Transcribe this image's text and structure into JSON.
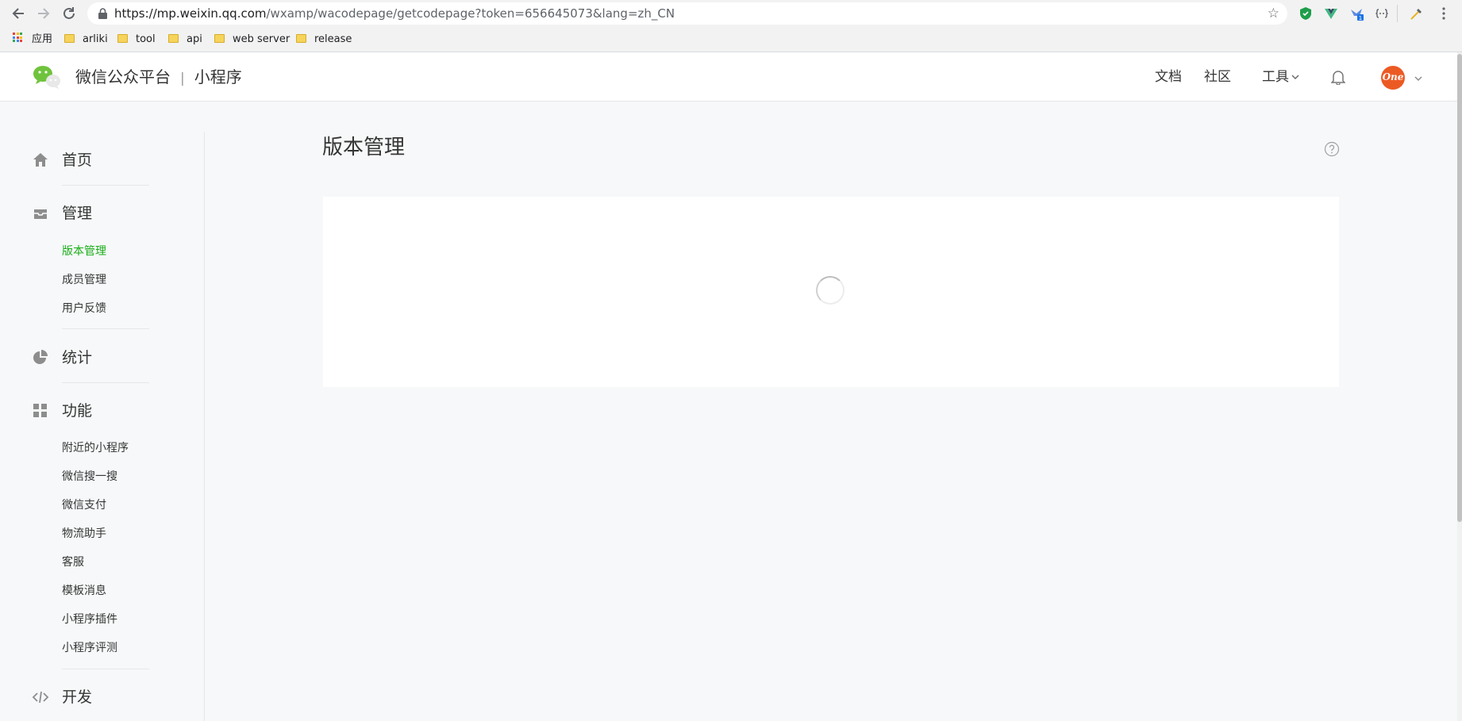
{
  "browser": {
    "url_host": "https://mp.weixin.qq.com",
    "url_path": "/wxamp/wacodepage/getcodepage?token=656645073&lang=zh_CN",
    "bookmarks": [
      {
        "label": "应用",
        "type": "apps"
      },
      {
        "label": "arliki",
        "type": "folder"
      },
      {
        "label": "tool",
        "type": "folder"
      },
      {
        "label": "api",
        "type": "folder"
      },
      {
        "label": "web server",
        "type": "folder"
      },
      {
        "label": "release",
        "type": "folder"
      }
    ],
    "extension_badge": "1"
  },
  "header": {
    "brand": "微信公众平台",
    "separator": "|",
    "product": "小程序",
    "nav": {
      "docs": "文档",
      "community": "社区",
      "tools": "工具"
    },
    "avatar_text": "One"
  },
  "sidebar": {
    "home": "首页",
    "manage": {
      "title": "管理",
      "items": [
        "版本管理",
        "成员管理",
        "用户反馈"
      ],
      "active_index": 0
    },
    "stats": "统计",
    "features": {
      "title": "功能",
      "items": [
        "附近的小程序",
        "微信搜一搜",
        "微信支付",
        "物流助手",
        "客服",
        "模板消息",
        "小程序插件",
        "小程序评测"
      ]
    },
    "develop": "开发"
  },
  "main": {
    "title": "版本管理",
    "loading": true
  },
  "colors": {
    "accent_green": "#1aad19",
    "page_bg": "#f6f8f9",
    "avatar_bg": "#ec5a24"
  }
}
